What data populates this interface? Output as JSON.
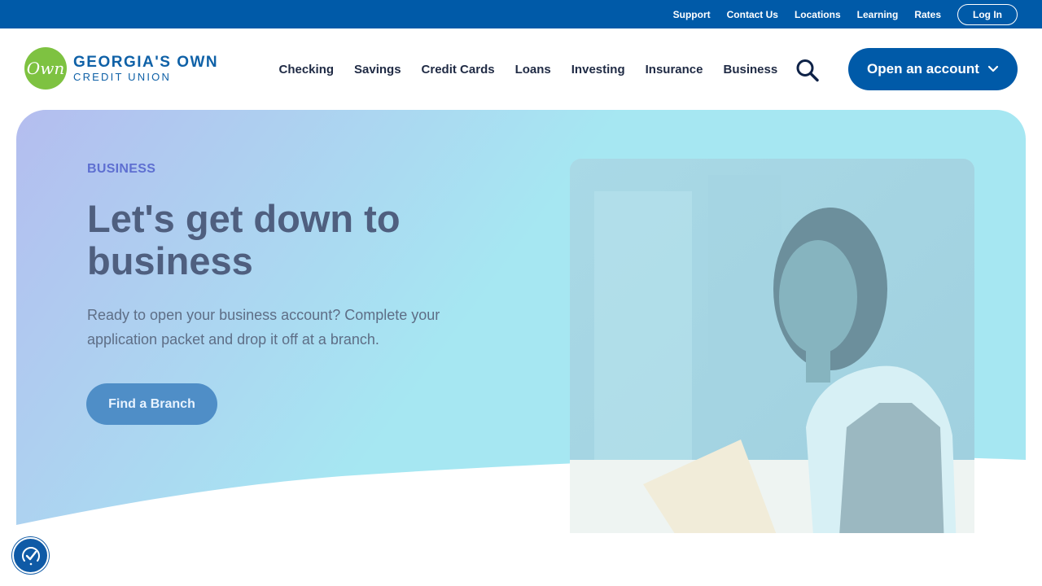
{
  "utility_bar": {
    "links": [
      "Support",
      "Contact Us",
      "Locations",
      "Learning",
      "Rates"
    ],
    "login_label": "Log In"
  },
  "brand": {
    "logo_mark": "Own",
    "name_line1": "GEORGIA'S OWN",
    "name_line2": "CREDIT UNION"
  },
  "nav": {
    "items": [
      "Checking",
      "Savings",
      "Credit Cards",
      "Loans",
      "Investing",
      "Insurance",
      "Business"
    ],
    "search_icon": "search-icon",
    "open_account_label": "Open an account"
  },
  "hero": {
    "eyebrow": "BUSINESS",
    "title": "Let's get down to business",
    "description": "Ready to open your business account? Complete your application packet and drop it off at a branch.",
    "cta_label": "Find a Branch"
  },
  "accessibility_icon": "accessibility-icon",
  "colors": {
    "primary": "#005aa8",
    "logo_green": "#7ec241",
    "gradient_start": "#b4bdef",
    "gradient_end": "#a6e7f2"
  }
}
